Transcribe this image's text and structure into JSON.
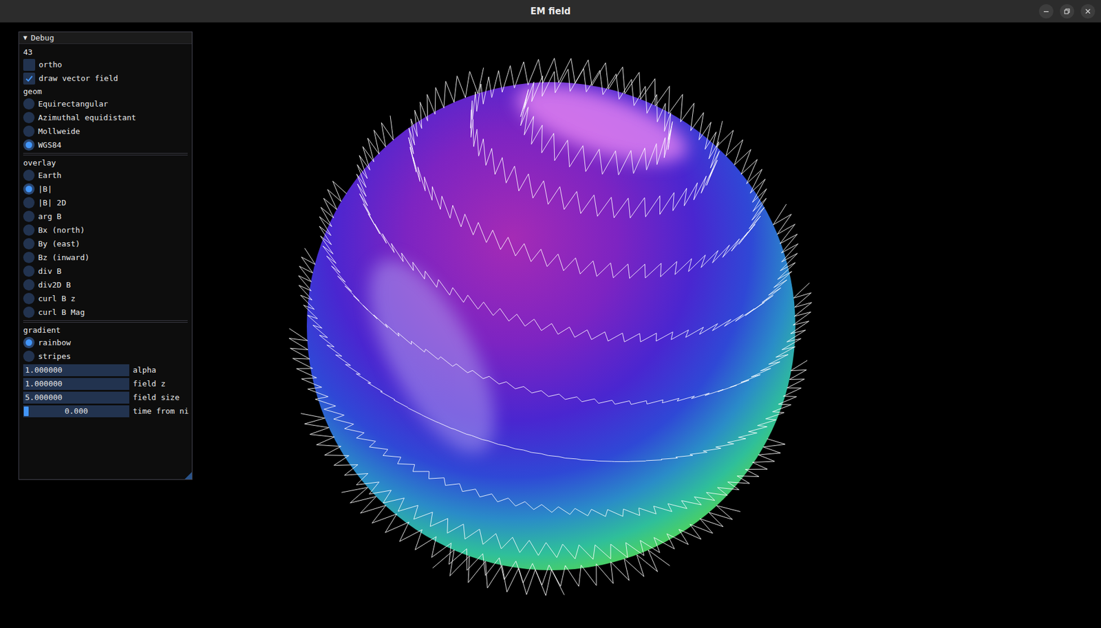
{
  "window": {
    "title": "EM field"
  },
  "panel": {
    "title": "Debug",
    "arrow": "▼",
    "expanded": true,
    "counter": "43",
    "toggles": [
      {
        "label": "ortho",
        "checked": false
      },
      {
        "label": "draw vector field",
        "checked": true
      }
    ],
    "groups": [
      {
        "label": "geom",
        "options": [
          {
            "label": "Equirectangular",
            "selected": false
          },
          {
            "label": "Azimuthal equidistant",
            "selected": false
          },
          {
            "label": "Mollweide",
            "selected": false
          },
          {
            "label": "WGS84",
            "selected": true
          }
        ]
      },
      {
        "label": "overlay",
        "options": [
          {
            "label": "Earth",
            "selected": false
          },
          {
            "label": "|B|",
            "selected": true
          },
          {
            "label": "|B| 2D",
            "selected": false
          },
          {
            "label": "arg B",
            "selected": false
          },
          {
            "label": "Bx (north)",
            "selected": false
          },
          {
            "label": "By (east)",
            "selected": false
          },
          {
            "label": "Bz (inward)",
            "selected": false
          },
          {
            "label": "div B",
            "selected": false
          },
          {
            "label": "div2D B",
            "selected": false
          },
          {
            "label": "curl B z",
            "selected": false
          },
          {
            "label": "curl B Mag",
            "selected": false
          }
        ]
      },
      {
        "label": "gradient",
        "options": [
          {
            "label": "rainbow",
            "selected": true
          },
          {
            "label": "stripes",
            "selected": false
          }
        ]
      }
    ],
    "fields": [
      {
        "kind": "input",
        "value": "1.000000",
        "label": "alpha"
      },
      {
        "kind": "input",
        "value": "1.000000",
        "label": "field z"
      },
      {
        "kind": "input",
        "value": "5.000000",
        "label": "field size"
      },
      {
        "kind": "slider",
        "value": "0.000",
        "label": "time from ni",
        "level": 0.0
      }
    ]
  }
}
